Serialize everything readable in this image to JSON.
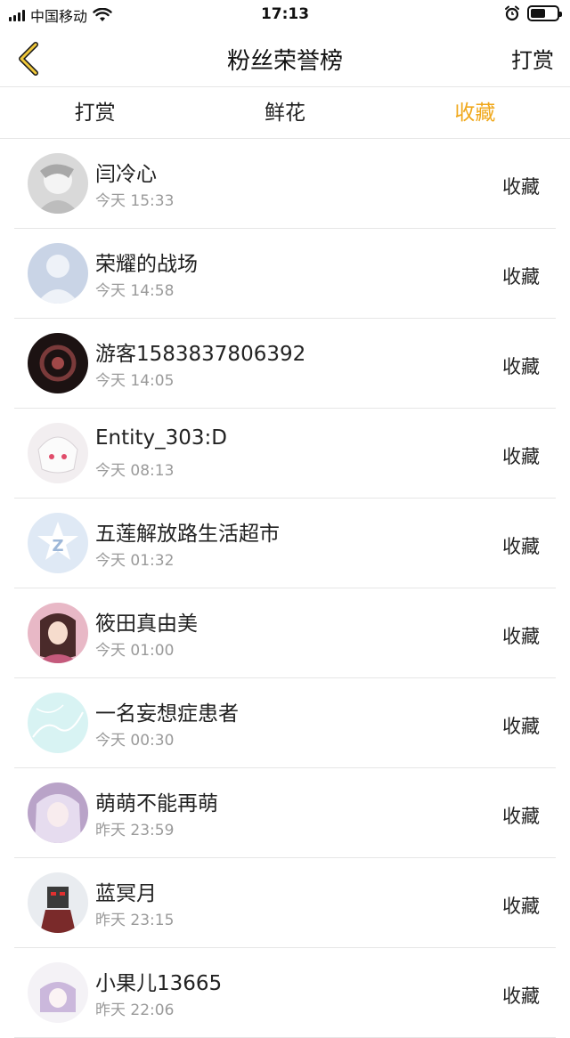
{
  "status_bar": {
    "carrier": "中国移动",
    "time": "17:13"
  },
  "nav": {
    "title": "粉丝荣誉榜",
    "action": "打赏",
    "accent_color": "#f0a81c"
  },
  "tabs": [
    {
      "label": "打赏",
      "active": false
    },
    {
      "label": "鲜花",
      "active": false
    },
    {
      "label": "收藏",
      "active": true
    }
  ],
  "list": [
    {
      "name": "闫冷心",
      "time": "今天 15:33",
      "type": "收藏"
    },
    {
      "name": "荣耀的战场",
      "time": "今天 14:58",
      "type": "收藏"
    },
    {
      "name": "游客1583837806392",
      "time": "今天 14:05",
      "type": "收藏"
    },
    {
      "name": "Entity_303:D",
      "time": "今天 08:13",
      "type": "收藏"
    },
    {
      "name": "五莲解放路生活超市",
      "time": "今天 01:32",
      "type": "收藏"
    },
    {
      "name": "筱田真由美",
      "time": "今天 01:00",
      "type": "收藏"
    },
    {
      "name": "一名妄想症患者",
      "time": "今天 00:30",
      "type": "收藏"
    },
    {
      "name": "萌萌不能再萌",
      "time": "昨天 23:59",
      "type": "收藏"
    },
    {
      "name": "蓝冥月",
      "time": "昨天 23:15",
      "type": "收藏"
    },
    {
      "name": "小果儿13665",
      "time": "昨天 22:06",
      "type": "收藏"
    }
  ]
}
